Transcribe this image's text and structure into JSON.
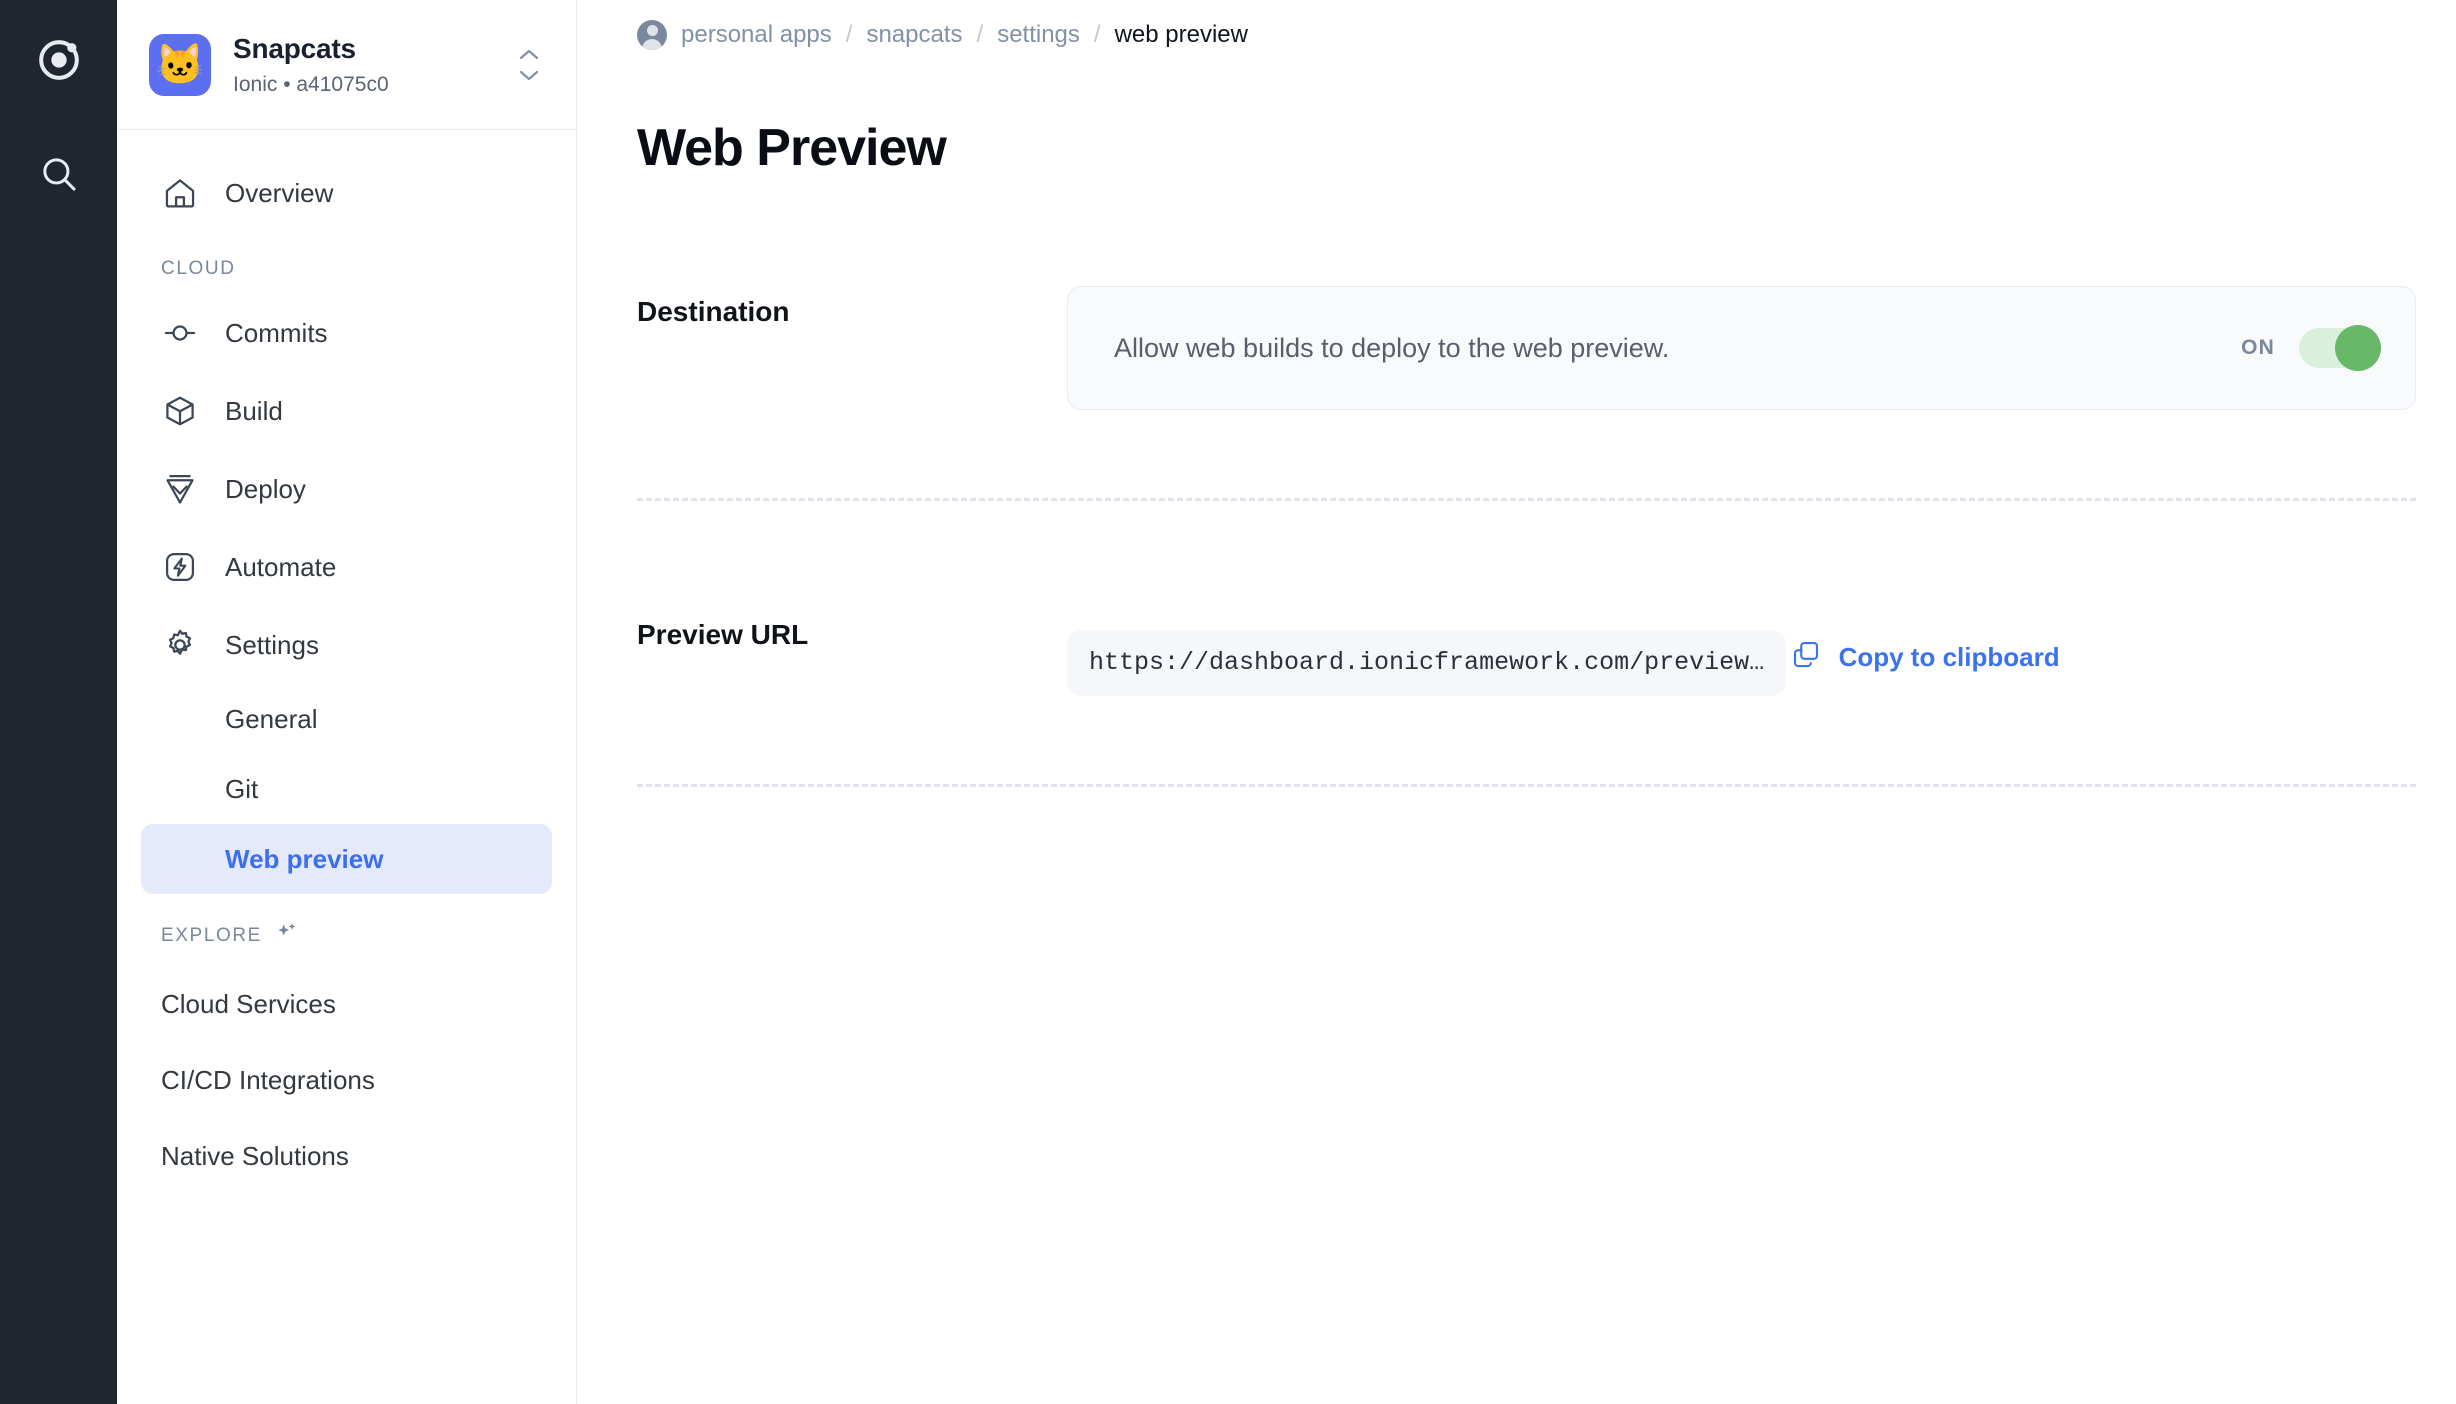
{
  "rail": {
    "logo_icon": "ionic-logo-icon",
    "search_icon": "search-icon"
  },
  "project": {
    "name": "Snapcats",
    "subtitle": "Ionic • a41075c0",
    "icon": "cat-app-icon",
    "icon_glyph": "🐱",
    "switcher_icon": "chevron-up-down-icon",
    "accent": "#5c6ef2"
  },
  "sidebar": {
    "overview": {
      "label": "Overview",
      "icon": "home-icon"
    },
    "cloud_section": {
      "label": "CLOUD"
    },
    "cloud_items": [
      {
        "label": "Commits",
        "icon": "commit-icon"
      },
      {
        "label": "Build",
        "icon": "box-icon"
      },
      {
        "label": "Deploy",
        "icon": "deploy-icon"
      },
      {
        "label": "Automate",
        "icon": "lightning-bolt-icon"
      },
      {
        "label": "Settings",
        "icon": "gear-icon"
      }
    ],
    "settings_children": [
      {
        "label": "General",
        "active": false
      },
      {
        "label": "Git",
        "active": false
      },
      {
        "label": "Web preview",
        "active": true
      }
    ],
    "explore_section": {
      "label": "EXPLORE",
      "icon": "sparkles-icon"
    },
    "explore_items": [
      {
        "label": "Cloud Services"
      },
      {
        "label": "CI/CD Integrations"
      },
      {
        "label": "Native Solutions"
      }
    ],
    "active_color": "#3b6ef0",
    "active_bg": "#e4eafc"
  },
  "breadcrumb": {
    "avatar_icon": "user-avatar-icon",
    "separator": "/",
    "items": [
      {
        "label": "personal apps",
        "current": false
      },
      {
        "label": "snapcats",
        "current": false
      },
      {
        "label": "settings",
        "current": false
      },
      {
        "label": "web preview",
        "current": true
      }
    ]
  },
  "page": {
    "title": "Web Preview"
  },
  "destination": {
    "label": "Destination",
    "description": "Allow web builds to deploy to the web preview.",
    "toggle_state": "ON",
    "toggle_on": true,
    "toggle_track_color": "#d8f0dc",
    "toggle_knob_color": "#68b868"
  },
  "preview_url": {
    "label": "Preview URL",
    "value": "https://dashboard.ionicframework.com/preview…",
    "copy_label": "Copy to clipboard",
    "copy_icon": "copy-icon",
    "link_color": "#3b72ef"
  }
}
